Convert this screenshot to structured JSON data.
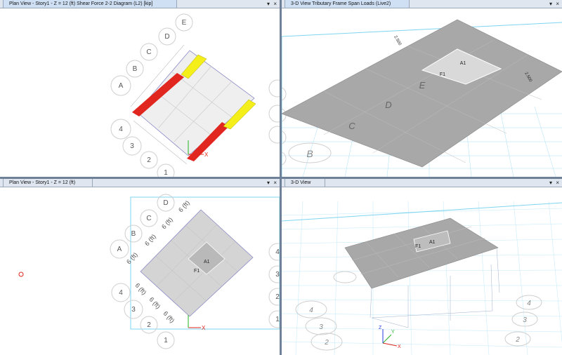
{
  "panes": {
    "top_left": {
      "title": "Plan View - Story1 - Z = 12 (ft)   Shear Force 2-2 Diagram   (L2)  [kip]",
      "pin": "▾",
      "close": "×"
    },
    "top_right": {
      "title": "3-D View  Tributary Frame Span Loads  (Live2)",
      "pin": "▾",
      "close": "×"
    },
    "bottom_left": {
      "title": "Plan View - Story1 - Z = 12 (ft)",
      "pin": "▾",
      "close": "×"
    },
    "bottom_right": {
      "title": "3-D View",
      "pin": "▾",
      "close": "×"
    }
  },
  "grid_letters": [
    "A",
    "B",
    "C",
    "D",
    "E"
  ],
  "grid_numbers": [
    "1",
    "2",
    "3",
    "4"
  ],
  "labels": {
    "area": "A1",
    "frame": "F1",
    "letter_E": "E",
    "letter_D": "D",
    "letter_C": "C",
    "letter_B": "B",
    "axis_x": "X",
    "axis_y": "Y",
    "axis_z": "Z",
    "dim_6ft": "6 (ft)",
    "load_val": "2.500"
  },
  "colors": {
    "shear_red": "#e0261f",
    "shear_yellow": "#f4ef1a",
    "slab_gray": "#a8a8a8",
    "grid_cyan": "#7fd5f0",
    "axis_red": "#e0261f",
    "axis_green": "#22b522",
    "axis_blue": "#2a3cdc"
  }
}
